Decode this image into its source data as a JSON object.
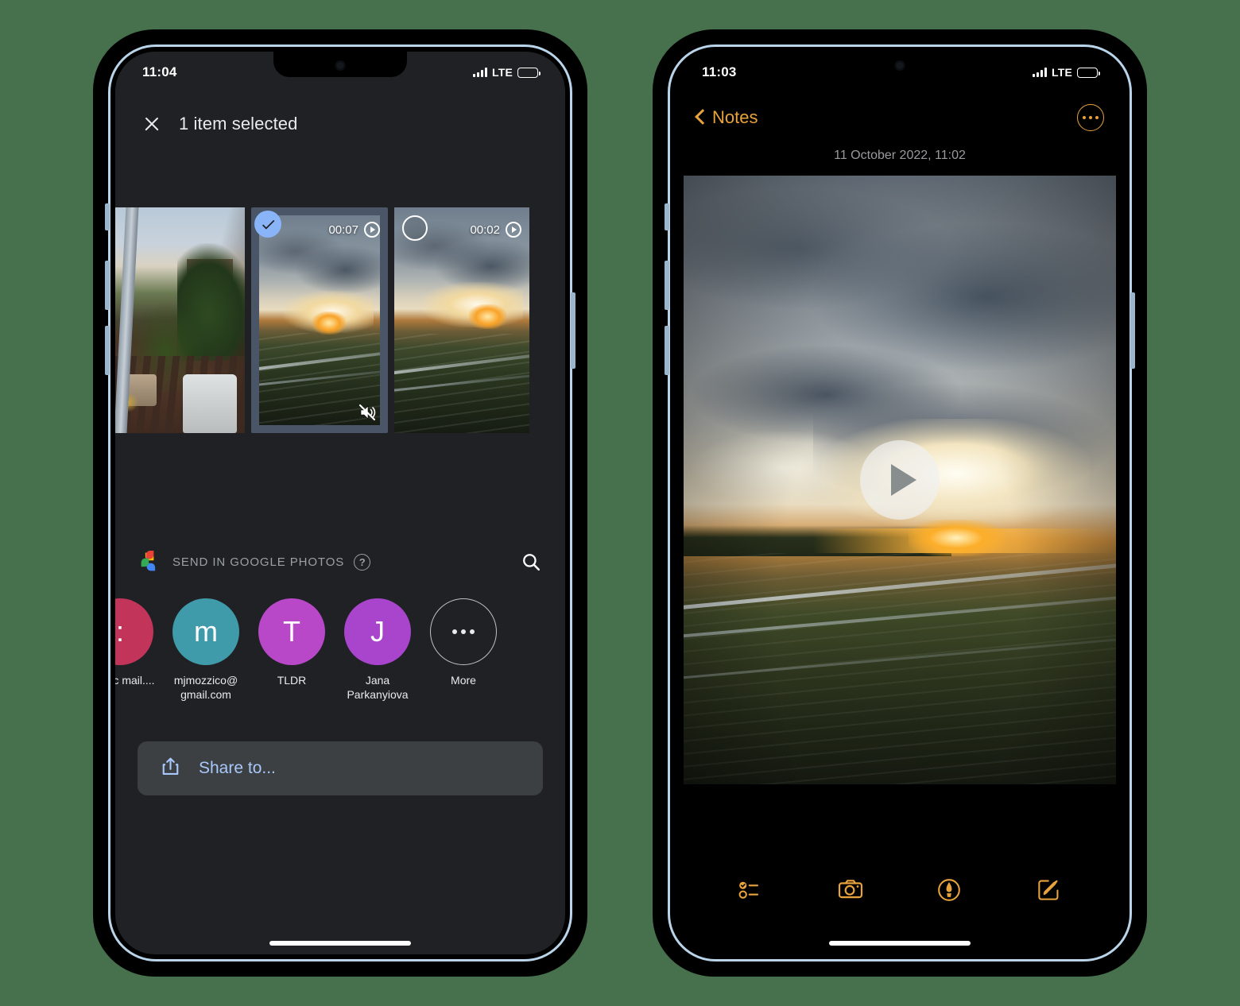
{
  "background_color": "#47704d",
  "phones": {
    "left": {
      "app": "google-photos-share-sheet",
      "status_bar": {
        "time": "11:04",
        "network": "LTE",
        "battery_icon": "battery-full-icon",
        "signal_icon": "cellular-bars-icon"
      },
      "top_bar": {
        "close_icon": "close-icon",
        "title": "1 item selected"
      },
      "thumbnails": [
        {
          "name": "balcony-photo",
          "type": "photo",
          "selected": false,
          "duration": "",
          "muted": false,
          "has_check": false
        },
        {
          "name": "sunset-video-7s",
          "type": "video",
          "selected": true,
          "duration": "00:07",
          "muted": true,
          "has_check": true
        },
        {
          "name": "sunset-video-2s",
          "type": "video",
          "selected": false,
          "duration": "00:02",
          "muted": false,
          "has_check": false
        }
      ],
      "send_row": {
        "logo_icon": "google-photos-logo-icon",
        "label": "SEND IN GOOGLE PHOTOS",
        "help_icon": "help-circle-icon",
        "help_glyph": "?",
        "search_icon": "search-icon"
      },
      "contacts": [
        {
          "initial": ":",
          "name": "a.ganc\nmail....",
          "color": "#c2345a"
        },
        {
          "initial": "m",
          "name": "mjmozzico@\ngmail.com",
          "color": "#3f9aaa"
        },
        {
          "initial": "T",
          "name": "TLDR",
          "color": "#b848c8"
        },
        {
          "initial": "J",
          "name": "Jana\nParkanyiova",
          "color": "#a845cc"
        },
        {
          "initial": "…",
          "name": "More",
          "color": "transparent"
        }
      ],
      "share_button": {
        "icon": "share-upload-icon",
        "label": "Share to...",
        "text_color": "#a8c7fa",
        "background": "#3c4043"
      }
    },
    "right": {
      "app": "apple-notes",
      "status_bar": {
        "time": "11:03",
        "network": "LTE",
        "battery_icon": "battery-full-icon",
        "signal_icon": "cellular-bars-icon"
      },
      "nav": {
        "back_icon": "chevron-left-icon",
        "back_label": "Notes",
        "more_icon": "more-circle-icon",
        "accent_color": "#e8a33d"
      },
      "note_date": "11 October 2022, 11:02",
      "media": {
        "type": "video",
        "play_icon": "play-button-icon"
      },
      "toolbar": [
        {
          "icon": "checklist-icon"
        },
        {
          "icon": "camera-icon"
        },
        {
          "icon": "markup-pen-icon"
        },
        {
          "icon": "compose-icon"
        }
      ]
    }
  }
}
